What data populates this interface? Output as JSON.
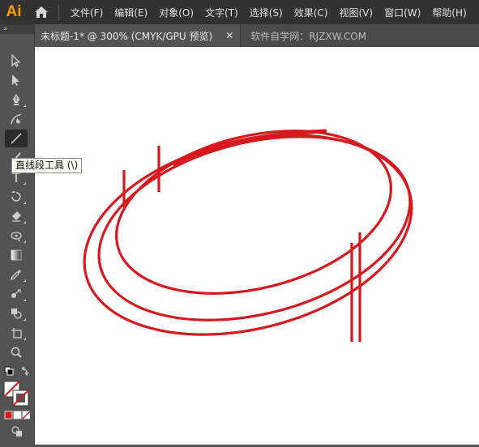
{
  "app": {
    "logo": "Ai",
    "home_icon": "home-icon"
  },
  "menu": [
    "文件(F)",
    "编辑(E)",
    "对象(O)",
    "文字(T)",
    "选择(S)",
    "效果(C)",
    "视图(V)",
    "窗口(W)",
    "帮助(H)"
  ],
  "tabs": {
    "active_title": "未标题-1* @ 300% (CMYK/GPU 预览)",
    "close_glyph": "✕",
    "watermark": "软件自学网：RJZXW.COM"
  },
  "toolbar": {
    "collapse_glyph": "»",
    "tools": [
      {
        "icon": "selection-tool-icon"
      },
      {
        "icon": "direct-selection-tool-icon"
      },
      {
        "icon": "pen-tool-icon"
      },
      {
        "icon": "curvature-tool-icon"
      },
      {
        "icon": "line-segment-tool-icon",
        "active": true
      },
      {
        "icon": "paintbrush-tool-icon"
      },
      {
        "icon": "type-tool-icon"
      },
      {
        "icon": "rotate-tool-icon"
      },
      {
        "icon": "eraser-tool-icon"
      },
      {
        "icon": "puppet-warp-tool-icon"
      },
      {
        "icon": "gradient-tool-icon"
      },
      {
        "icon": "eyedropper-tool-icon"
      },
      {
        "icon": "symbol-sprayer-tool-icon"
      },
      {
        "icon": "shape-builder-tool-icon"
      },
      {
        "icon": "artboard-tool-icon"
      },
      {
        "icon": "zoom-tool-icon"
      }
    ],
    "tooltip": "直线段工具 (\\)"
  },
  "colors": {
    "stroke": "#d7191f",
    "accent": "#ff9a00",
    "canvas": "#ffffff"
  }
}
